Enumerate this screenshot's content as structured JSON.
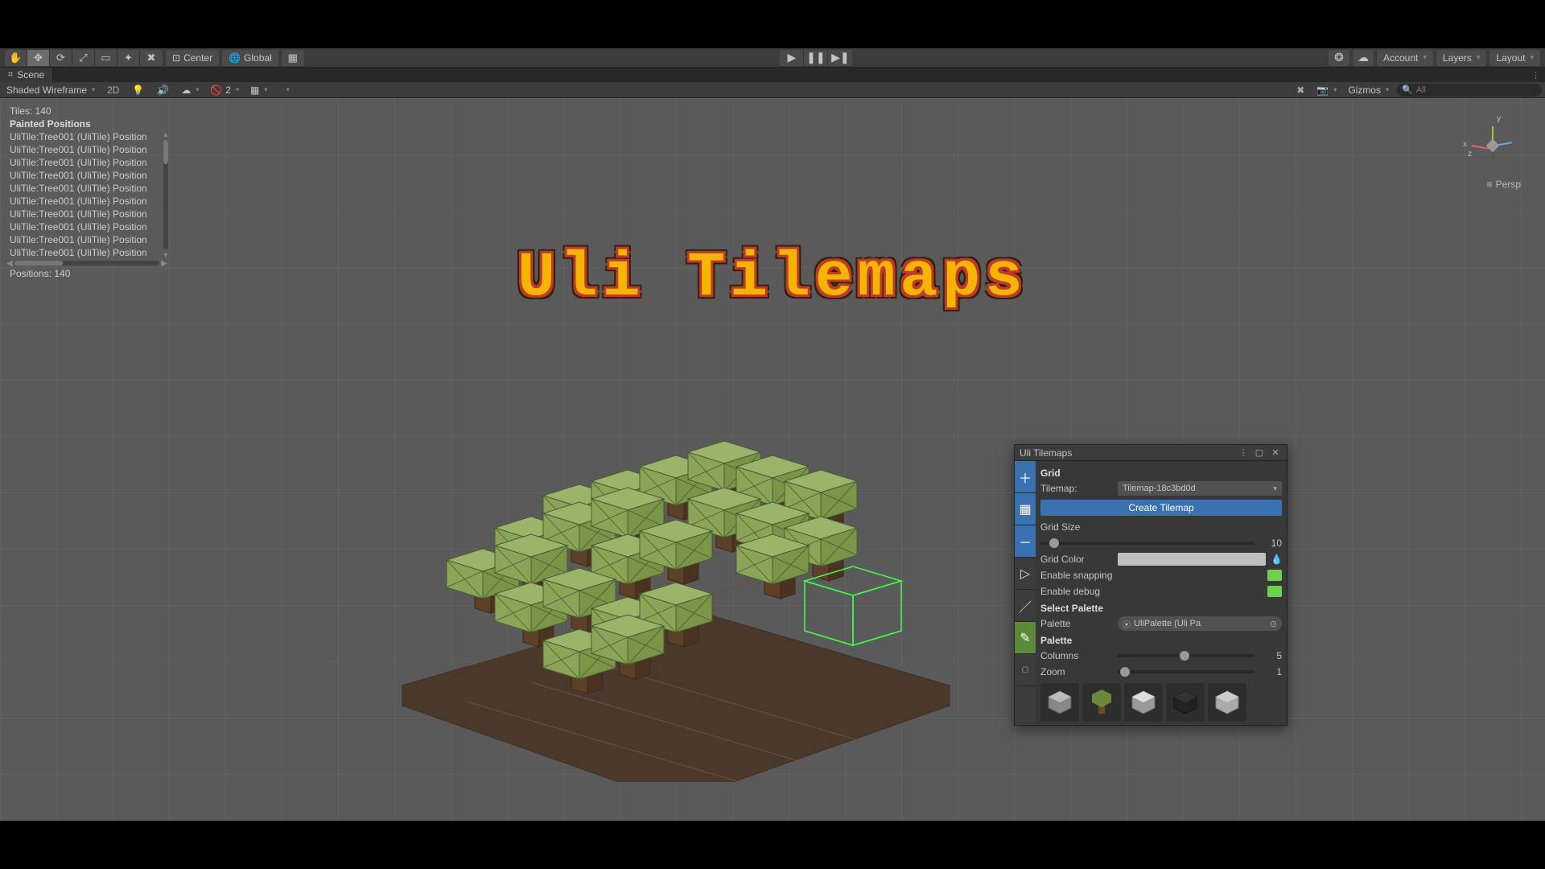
{
  "toolbar": {
    "pivot": "Center",
    "handle": "Global",
    "account": "Account",
    "layers": "Layers",
    "layout": "Layout"
  },
  "tab": {
    "name": "Scene"
  },
  "scene_toolbar": {
    "shading": "Shaded Wireframe",
    "mode2d": "2D",
    "hidden_count": "2",
    "gizmos": "Gizmos",
    "search_placeholder": "All"
  },
  "overlay": {
    "tiles_label": "Tiles: 140",
    "painted_header": "Painted Positions",
    "items": [
      "UliTile:Tree001 (UliTile) Position",
      "UliTile:Tree001 (UliTile) Position",
      "UliTile:Tree001 (UliTile) Position",
      "UliTile:Tree001 (UliTile) Position",
      "UliTile:Tree001 (UliTile) Position",
      "UliTile:Tree001 (UliTile) Position",
      "UliTile:Tree001 (UliTile) Position",
      "UliTile:Tree001 (UliTile) Position",
      "UliTile:Tree001 (UliTile) Position",
      "UliTile:Tree001 (UliTile) Position"
    ],
    "positions_label": "Positions: 140"
  },
  "axis": {
    "x": "x",
    "y": "y",
    "z": "z",
    "persp": "Persp"
  },
  "title": "Uli Tilemaps",
  "panel": {
    "title": "Uli Tilemaps",
    "grid_header": "Grid",
    "tilemap_label": "Tilemap:",
    "tilemap_value": "Tilemap-18c3bd0d",
    "create_btn": "Create Tilemap",
    "grid_size_label": "Grid Size",
    "grid_size_value": "10",
    "grid_color_label": "Grid Color",
    "enable_snapping": "Enable snapping",
    "enable_debug": "Enable debug",
    "select_palette_header": "Select Palette",
    "palette_label": "Palette",
    "palette_value": "UliPalette (Uli Pa",
    "palette_header": "Palette",
    "columns_label": "Columns",
    "columns_value": "5",
    "zoom_label": "Zoom",
    "zoom_value": "1"
  }
}
